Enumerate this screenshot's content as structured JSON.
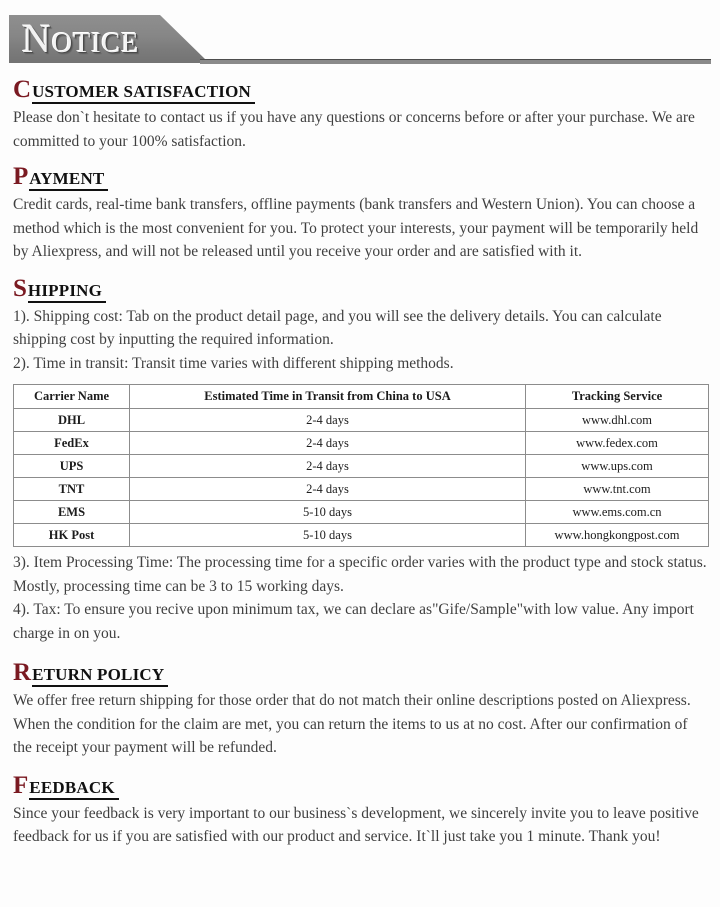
{
  "banner": {
    "title": "Notice"
  },
  "sections": [
    {
      "id": "customer-satisfaction",
      "dropcap": "C",
      "heading_rest": "USTOMER SATISFACTION",
      "paragraphs": [
        "Please don`t hesitate to contact us if you have any questions or concerns before or after your purchase. We are committed to your 100% satisfaction."
      ]
    },
    {
      "id": "payment",
      "dropcap": "P",
      "heading_rest": "AYMENT",
      "paragraphs": [
        "Credit cards, real-time bank transfers, offline payments (bank transfers and Western Union). You can choose a method which is the most convenient for you. To protect your interests, your payment will be temporarily held by Aliexpress, and will not be released until you receive your order and are satisfied with it."
      ]
    },
    {
      "id": "shipping",
      "dropcap": "S",
      "heading_rest": "HIPPING",
      "lines_before_table": [
        "1). Shipping cost:  Tab on the product detail page, and you will see the delivery details. You can calculate shipping cost by inputting the required information.",
        "2). Time in transit: Transit time varies with different shipping methods."
      ],
      "lines_after_table": [
        "3). Item Processing Time: The processing time for a specific order varies with the product type and stock status. Mostly, processing time can be 3 to 15 working days.",
        "4). Tax: To ensure you recive upon minimum tax, we can declare as\"Gife/Sample\"with low value. Any import charge in on you."
      ]
    },
    {
      "id": "return-policy",
      "dropcap": "R",
      "heading_rest": "ETURN POLICY",
      "paragraphs": [
        "We offer free return shipping for those order that do not match their online descriptions posted on Aliexpress. When the condition for the claim are met, you can return the items to us at no cost. After our confirmation of the receipt your payment will be refunded."
      ]
    },
    {
      "id": "feedback",
      "dropcap": "F",
      "heading_rest": "EEDBACK",
      "paragraphs": [
        "Since your feedback is very important to our business`s development, we sincerely invite you to leave positive feedback for us if you are satisfied with our product and service. It`ll just take you 1 minute. Thank you!"
      ]
    }
  ],
  "shipping_table": {
    "headers": [
      "Carrier Name",
      "Estimated Time in Transit from China to USA",
      "Tracking Service"
    ],
    "rows": [
      {
        "carrier": "DHL",
        "transit": "2-4 days",
        "tracking": "www.dhl.com"
      },
      {
        "carrier": "FedEx",
        "transit": "2-4 days",
        "tracking": "www.fedex.com"
      },
      {
        "carrier": "UPS",
        "transit": "2-4 days",
        "tracking": "www.ups.com"
      },
      {
        "carrier": "TNT",
        "transit": "2-4 days",
        "tracking": "www.tnt.com"
      },
      {
        "carrier": "EMS",
        "transit": "5-10 days",
        "tracking": "www.ems.com.cn"
      },
      {
        "carrier": "HK Post",
        "transit": "5-10 days",
        "tracking": "www.hongkongpost.com"
      }
    ]
  },
  "colors": {
    "dropcap": "#7a1a22",
    "heading": "#111111",
    "body": "#3f3f3f",
    "banner_gray": "#868686",
    "table_border": "#8c8c8c"
  }
}
